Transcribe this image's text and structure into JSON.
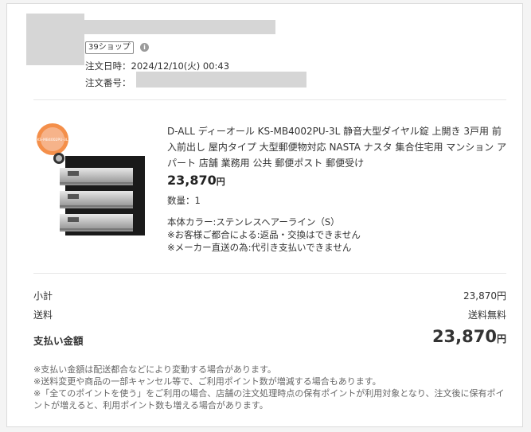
{
  "shop": {
    "badge": "39ショップ"
  },
  "order": {
    "date_label": "注文日時：",
    "date_value": "2024/12/10(火) 00:43",
    "number_label": "注文番号："
  },
  "product": {
    "title": "D-ALL ディーオール KS-MB4002PU-3L 静音大型ダイヤル錠 上開き 3戸用 前入前出し 屋内タイプ 大型郵便物対応 NASTA ナスタ 集合住宅用 マンション アパート 店舗 業務用 公共 郵便ポスト 郵便受け",
    "price": "23,870",
    "price_unit": "円",
    "quantity": "数量：1",
    "options": [
      "本体カラー:ステンレスヘアーライン（S）",
      "※お客様ご都合による:返品・交換はできません",
      "※メーカー直送の為:代引き支払いできません"
    ],
    "image_badge_text": "KS-MB4002PU-3L"
  },
  "summary": {
    "subtotal_label": "小計",
    "subtotal_value": "23,870円",
    "shipping_label": "送料",
    "shipping_value": "送料無料",
    "total_label": "支払い金額",
    "total_value": "23,870",
    "total_unit": "円"
  },
  "notes": [
    "※支払い金額は配送都合などにより変動する場合があります。",
    "※送料変更や商品の一部キャンセル等で、ご利用ポイント数が増減する場合もあります。",
    "※「全てのポイントを使う」をご利用の場合、店舗の注文処理時点の保有ポイントが利用対象となり、注文後に保有ポイントが増えると、利用ポイント数も増える場合があります。"
  ]
}
